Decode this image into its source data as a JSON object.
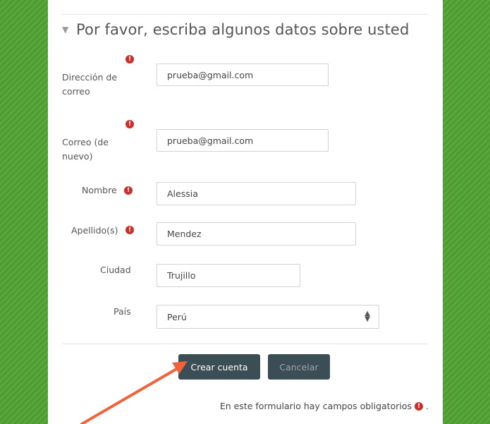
{
  "section": {
    "title": "Por favor, escriba algunos datos sobre usted"
  },
  "fields": {
    "email": {
      "label_line1": "Dirección de",
      "label_line2": "correo",
      "value": "prueba@gmail.com"
    },
    "email2": {
      "label_line1": "Correo (de",
      "label_line2": "nuevo)",
      "value": "prueba@gmail.com"
    },
    "firstname": {
      "label": "Nombre",
      "value": "Alessia"
    },
    "lastname": {
      "label": "Apellido(s)",
      "value": "Mendez"
    },
    "city": {
      "label": "Ciudad",
      "value": "Trujillo"
    },
    "country": {
      "label": "País",
      "value": "Perú"
    }
  },
  "required_marker": "!",
  "buttons": {
    "submit_label": "Crear cuenta",
    "cancel_label": "Cancelar"
  },
  "footer": {
    "note": "En este formulario hay campos obligatorios",
    "note_end": "."
  },
  "colors": {
    "background": "#5aa73b",
    "required": "#c9302c",
    "button": "#3c4e55",
    "annotation_arrow": "#f0643c"
  },
  "icons": {
    "collapse": "caret-down-icon",
    "required": "exclamation-circle-icon",
    "select": "sort-arrows-icon"
  }
}
